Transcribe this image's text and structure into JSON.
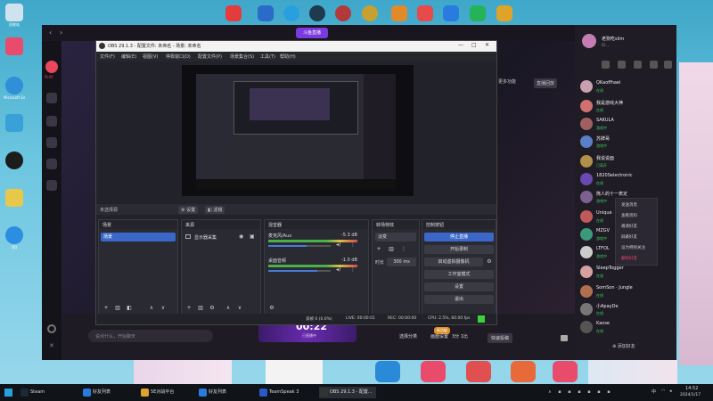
{
  "desktop": {
    "icons": [
      {
        "label": "回收站",
        "color": "#cfe3ef"
      },
      {
        "label": "",
        "color": "#e84b6b"
      },
      {
        "label": "Microsoft Edge",
        "color": "#2f8fd8"
      },
      {
        "label": "",
        "color": "#3aa0d8"
      },
      {
        "label": "",
        "color": "#1c1c1c"
      },
      {
        "label": "",
        "color": "#e8c84b"
      },
      {
        "label": "QQ",
        "color": "#2b8ee0"
      }
    ],
    "top_icons": [
      {
        "color": "#e43c3c"
      },
      {
        "color": "#c43a3a"
      },
      {
        "color": "#2a9fe0"
      },
      {
        "color": "#1f3a4e"
      },
      {
        "color": "#b33a3a"
      },
      {
        "color": "#c7a030"
      },
      {
        "color": "#e28a2a"
      },
      {
        "color": "#e64a4a"
      },
      {
        "color": "#2a7be0"
      },
      {
        "color": "#25b35a"
      },
      {
        "color": "#e0a32a"
      }
    ]
  },
  "host_app": {
    "logo_text": "斗鱼直播",
    "play_label": "PLAY",
    "more_btn": "更多功能",
    "replay_btn": "直播回放",
    "chat_placeholder": "说点什么，开始聊天",
    "timer": "00:22",
    "timer_sub": "已直播中",
    "bottom_btns": [
      "选择分类",
      "画面设置",
      "3分 1比",
      "快速投稿"
    ],
    "badge": "新功能"
  },
  "chat_panel": {
    "user_name": "老狗吃slim",
    "user_id": "ID:...",
    "friends": [
      {
        "name": "QKaoffhaei",
        "status": "在线",
        "color": "#c9a0b0"
      },
      {
        "name": "我是游戏大神",
        "status": "在线",
        "color": "#d07070"
      },
      {
        "name": "SAKULA",
        "status": "游戏中",
        "color": "#a06060"
      },
      {
        "name": "苏牌哥",
        "status": "游戏中",
        "color": "#5a7ec8"
      },
      {
        "name": "我说说面",
        "status": "已离开",
        "color": "#b0904a"
      },
      {
        "name": "1820Selectronic",
        "status": "在线",
        "color": "#6a4ab0"
      },
      {
        "name": "熊人的十一表定",
        "status": "游戏中",
        "color": "#7c6090"
      },
      {
        "name": "Unique",
        "status": "在线",
        "color": "#c05a5a"
      },
      {
        "name": "MZGV",
        "status": "游戏中",
        "color": "#3a9a7a"
      },
      {
        "name": "LTFOL",
        "status": "游戏中",
        "color": "#ccc"
      },
      {
        "name": "SleepTogger",
        "status": "在线",
        "color": "#d7a0a0"
      },
      {
        "name": "SomSon · Jungle",
        "status": "在线",
        "color": "#b07050"
      },
      {
        "name": "小ApayDe",
        "status": "在线",
        "color": "#777"
      },
      {
        "name": "Kaose",
        "status": "在线",
        "color": "#555"
      }
    ],
    "context_menu": [
      "发送消息",
      "查看资料",
      "邀请好友",
      "屏蔽好友",
      "设为特别关注",
      "删除好友"
    ],
    "add_friend": "添加好友"
  },
  "obs": {
    "title": "OBS 29.1.3 - 配置文件: 未命名 - 场景: 未命名",
    "menu": [
      "文件(F)",
      "编辑(E)",
      "视图(V)",
      "停靠窗口(D)",
      "配置文件(P)",
      "场景集合(S)",
      "工具(T)",
      "帮助(H)"
    ],
    "toolbar": {
      "source_label": "未选择源",
      "settings": "设置",
      "filter": "滤镜"
    },
    "docks": {
      "scenes": {
        "title": "场景",
        "items": [
          "场景"
        ]
      },
      "sources": {
        "title": "来源",
        "items": [
          "显示器采集"
        ]
      },
      "mixer": {
        "title": "混音器",
        "tracks": [
          {
            "name": "麦克风/Aux",
            "db": "-5.3 dB",
            "level": 0.62
          },
          {
            "name": "桌面音频",
            "db": "-1.0 dB",
            "level": 0.78
          }
        ]
      },
      "transitions": {
        "title": "转场特效",
        "type": "淡变",
        "duration_label": "时长",
        "duration": "300 ms"
      },
      "controls": {
        "title": "控制按钮",
        "buttons": [
          "停止直播",
          "开始录制",
          "启动虚拟摄像机",
          "工作室模式",
          "设置",
          "退出"
        ]
      }
    },
    "status": {
      "dropped": "丢帧 0 (0.0%)",
      "live": "LIVE: 00:00:01",
      "rec": "REC: 00:00:00",
      "cpu": "CPU: 2.5%, 60.00 fps",
      "kb": "kb/s"
    }
  },
  "taskbar": {
    "items": [
      {
        "label": "Steam",
        "color": "#1b2838"
      },
      {
        "label": "好友列表",
        "color": "#2a7be0"
      },
      {
        "label": "5E对战平台",
        "color": "#e0a030"
      },
      {
        "label": "好友列表",
        "color": "#2a7be0"
      },
      {
        "label": "TeamSpeak 3",
        "color": "#2a5ac8"
      },
      {
        "label": "OBS 29.1.3 - 配置...",
        "color": "#333"
      }
    ],
    "time": "14:52",
    "date": "2024/1/17",
    "lang": "中"
  },
  "dock_apps": [
    {
      "color": "#2a8ad8"
    },
    {
      "color": "#e84c6a"
    },
    {
      "color": "#e05050"
    },
    {
      "color": "#e86a3a"
    },
    {
      "color": "#e84c6a"
    }
  ]
}
